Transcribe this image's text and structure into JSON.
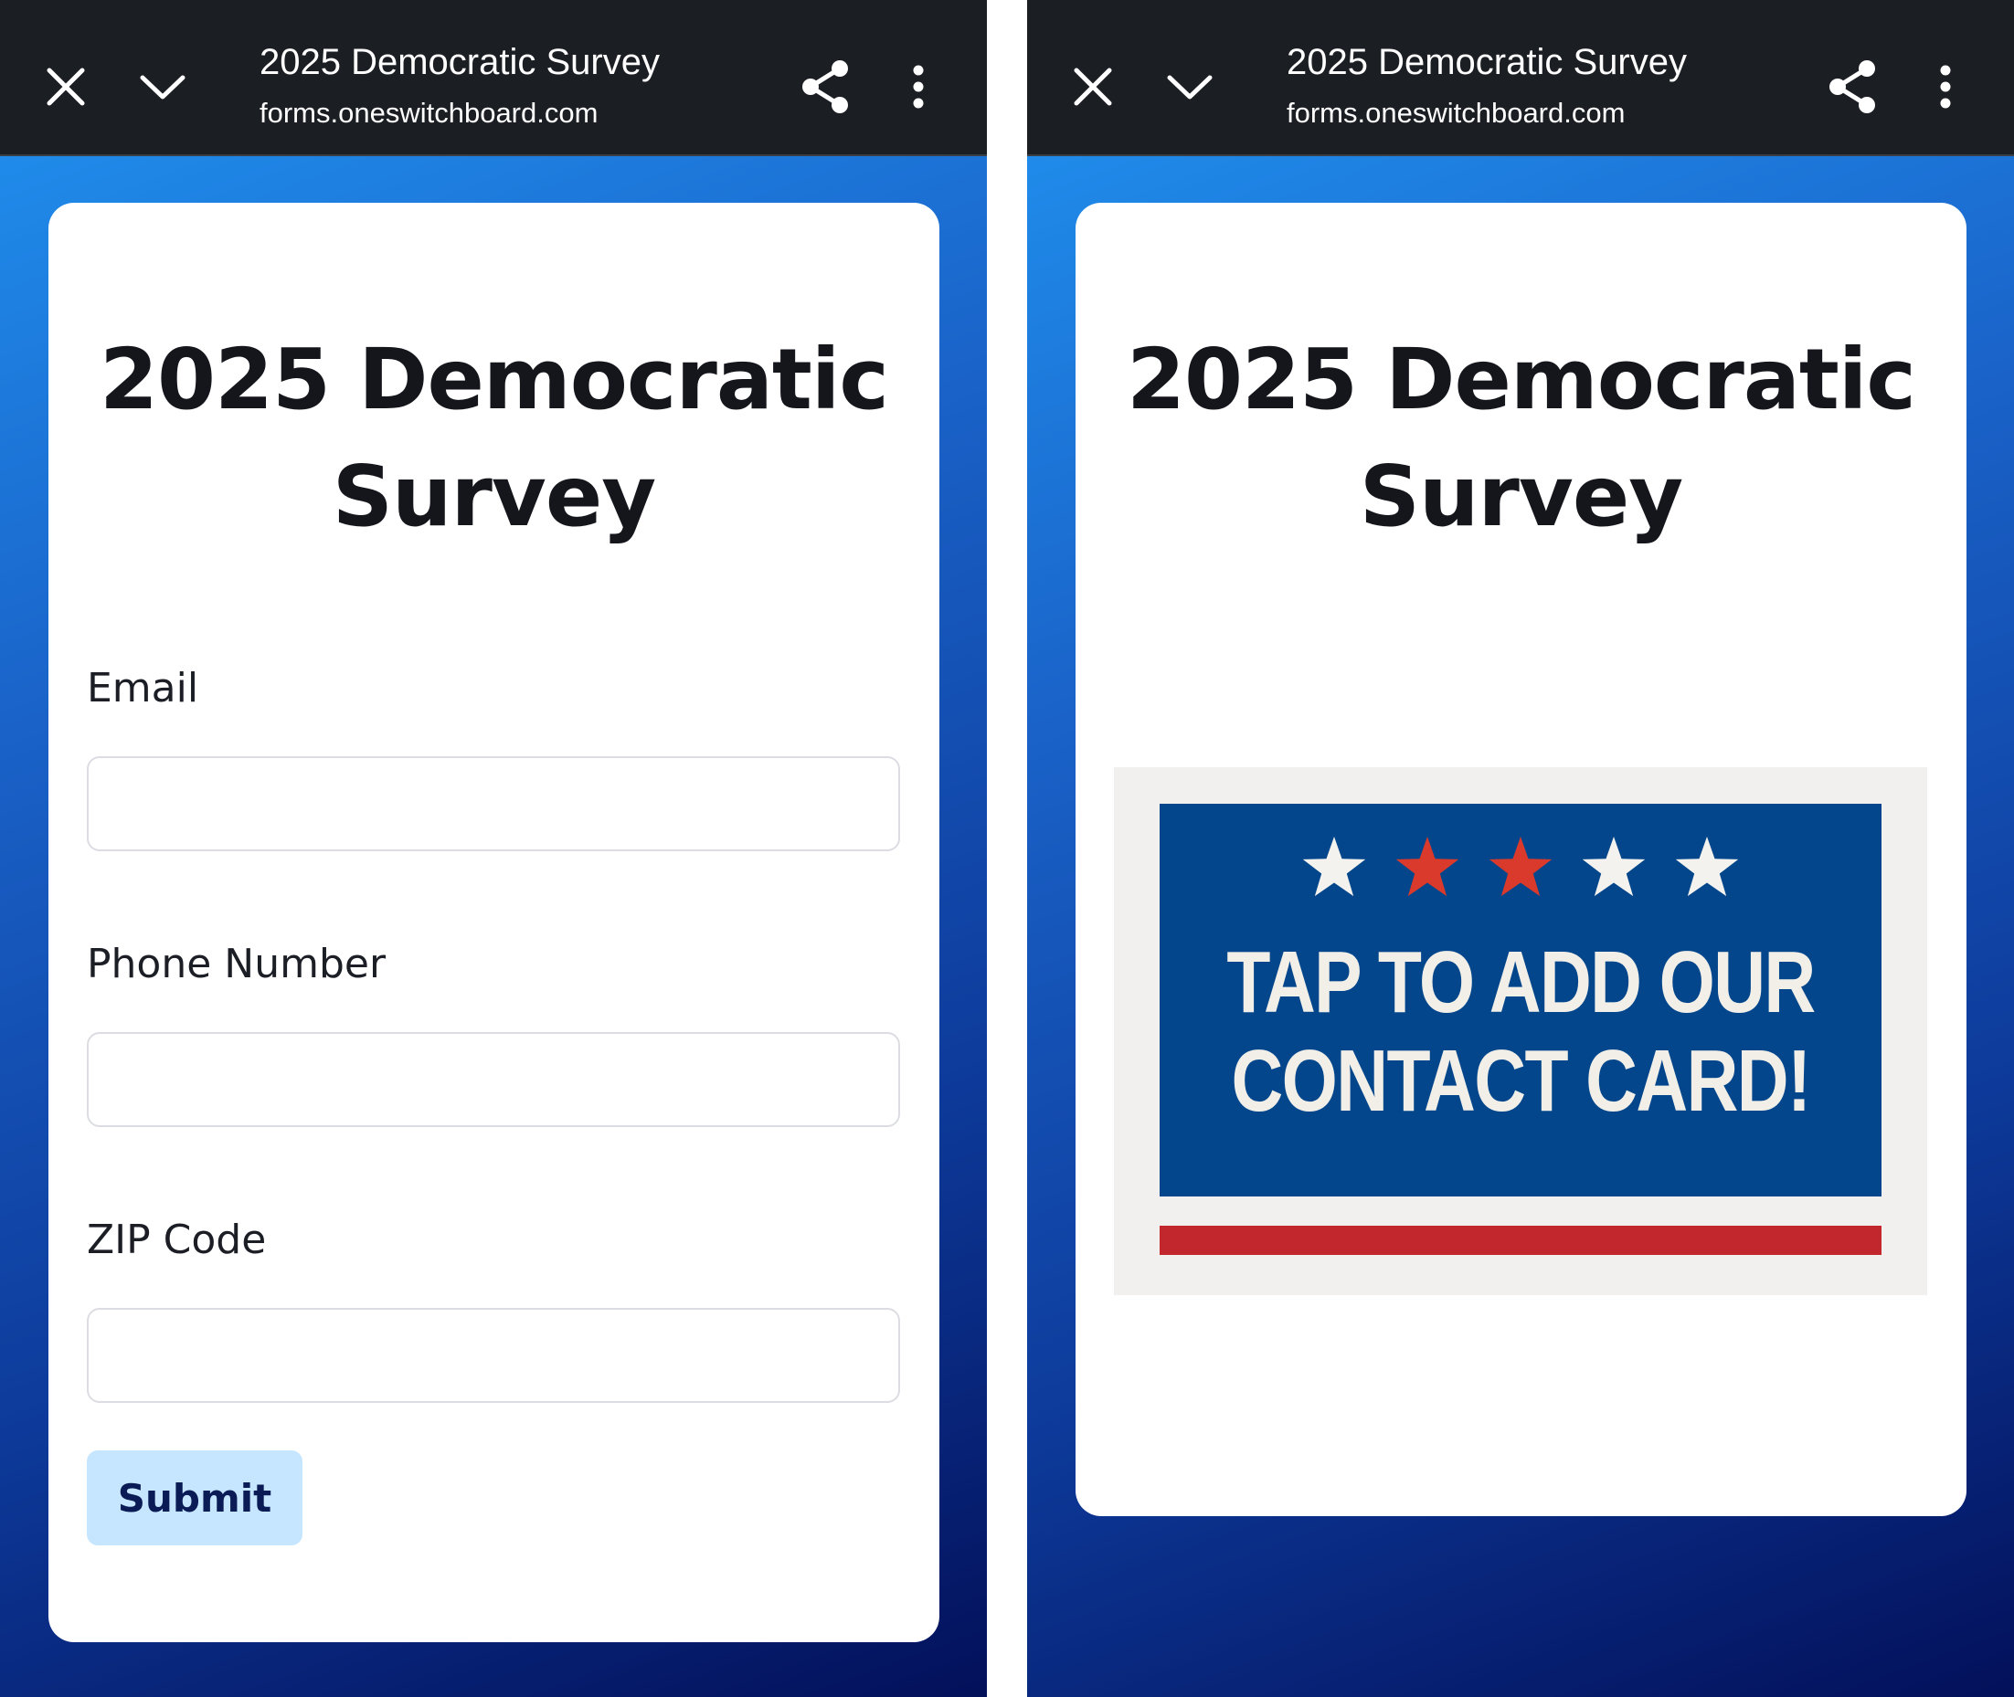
{
  "toolbar": {
    "title": "2025 Democratic Survey",
    "url": "forms.oneswitchboard.com",
    "icons": [
      "close-icon",
      "chevron-down-icon",
      "share-icon",
      "more-vert-icon"
    ]
  },
  "form": {
    "title": "2025 Democratic Survey",
    "fields": [
      {
        "label": "Email",
        "value": "",
        "placeholder": ""
      },
      {
        "label": "Phone Number",
        "value": "",
        "placeholder": ""
      },
      {
        "label": "ZIP Code",
        "value": "",
        "placeholder": ""
      }
    ],
    "submit_label": "Submit"
  },
  "contact_page": {
    "title": "2025 Democratic Survey",
    "banner_text": "TAP TO ADD OUR CONTACT CARD!",
    "stars": [
      "white",
      "red",
      "red",
      "white",
      "white"
    ]
  },
  "colors": {
    "toolbar_bg": "#1b1e23",
    "gradient_top": "#2196f3",
    "gradient_bottom": "#03105a",
    "submit_bg": "#c6e6ff",
    "banner_blue": "#04468b",
    "banner_red": "#c1272d",
    "star_white": "#f3f2ee",
    "star_red": "#d93a2b"
  }
}
